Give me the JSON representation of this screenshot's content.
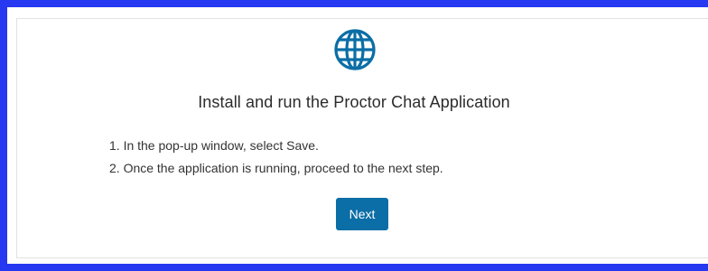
{
  "dialog": {
    "icon": "globe-icon",
    "title": "Install and run the Proctor Chat Application",
    "steps": [
      "1. In the pop-up window, select Save.",
      "2. Once the application is running, proceed to the next step."
    ],
    "next_label": "Next"
  },
  "colors": {
    "border": "#2638f0",
    "icon": "#0b6ea6",
    "button": "#0b6ea6",
    "text": "#333333"
  }
}
